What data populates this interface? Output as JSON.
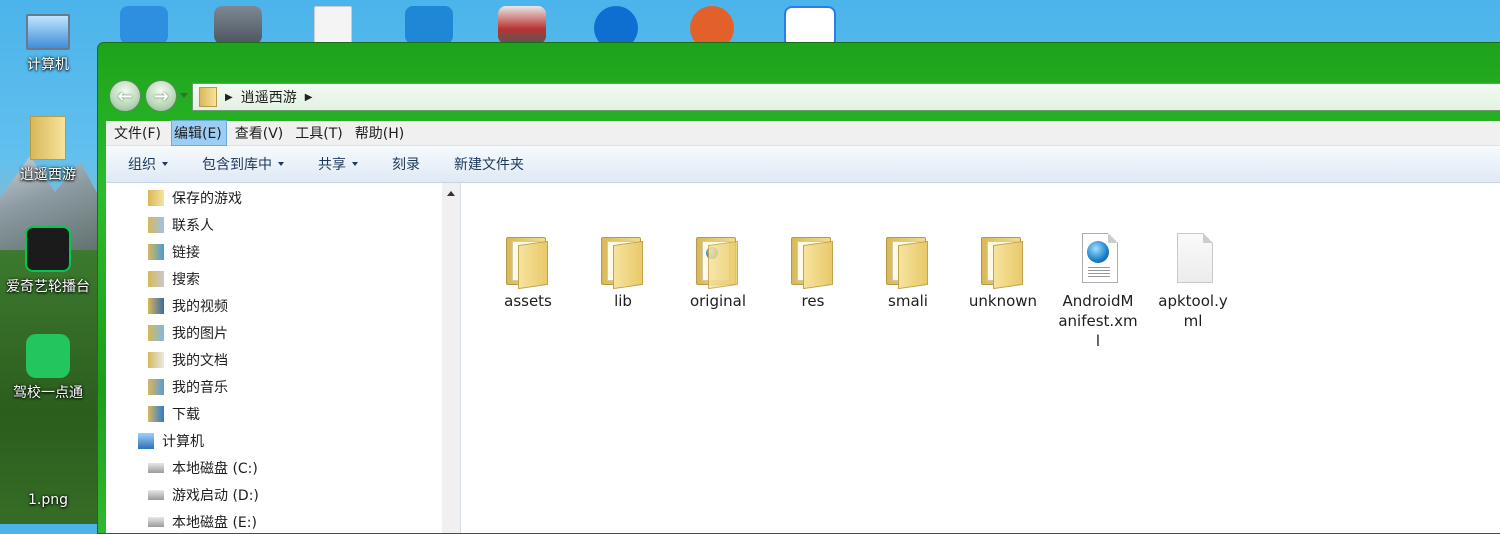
{
  "desktop": {
    "icons": [
      {
        "label": "计算机",
        "icon": "computer-icon"
      },
      {
        "label": "逍遥西游",
        "icon": "folder-icon"
      },
      {
        "label": "爱奇艺轮播台",
        "icon": "iqiyi-icon"
      },
      {
        "label": "驾校一点通",
        "icon": "jiaxiao-icon"
      },
      {
        "label": "1.png",
        "icon": "image-file-icon"
      }
    ],
    "top_icons": [
      "settings-app-icon",
      "lock-app-icon",
      "document-icon",
      "bug-app-icon",
      "webpage-icon",
      "teamviewer-icon",
      "fox-game-icon",
      "baidu-netdisk-icon"
    ]
  },
  "window": {
    "address": {
      "segments": [
        "逍遥西游"
      ]
    },
    "menubar": {
      "items": [
        {
          "label": "文件(F)",
          "active": false
        },
        {
          "label": "编辑(E)",
          "active": true
        },
        {
          "label": "查看(V)",
          "active": false
        },
        {
          "label": "工具(T)",
          "active": false
        },
        {
          "label": "帮助(H)",
          "active": false
        }
      ]
    },
    "toolbar": {
      "organize": "组织",
      "include_library": "包含到库中",
      "share": "共享",
      "burn": "刻录",
      "new_folder": "新建文件夹"
    },
    "navpane": {
      "items": [
        {
          "label": "保存的游戏"
        },
        {
          "label": "联系人"
        },
        {
          "label": "链接"
        },
        {
          "label": "搜索"
        },
        {
          "label": "我的视频"
        },
        {
          "label": "我的图片"
        },
        {
          "label": "我的文档"
        },
        {
          "label": "我的音乐"
        },
        {
          "label": "下载"
        },
        {
          "label": "计算机"
        },
        {
          "label": "本地磁盘 (C:)"
        },
        {
          "label": "游戏启动 (D:)"
        },
        {
          "label": "本地磁盘 (E:)"
        }
      ]
    },
    "files": [
      {
        "name": "assets",
        "type": "folder"
      },
      {
        "name": "lib",
        "type": "folder"
      },
      {
        "name": "original",
        "type": "folder-doc"
      },
      {
        "name": "res",
        "type": "folder"
      },
      {
        "name": "smali",
        "type": "folder"
      },
      {
        "name": "unknown",
        "type": "folder"
      },
      {
        "name": "AndroidManifest.xml",
        "type": "xml"
      },
      {
        "name": "apktool.yml",
        "type": "blank"
      }
    ]
  }
}
